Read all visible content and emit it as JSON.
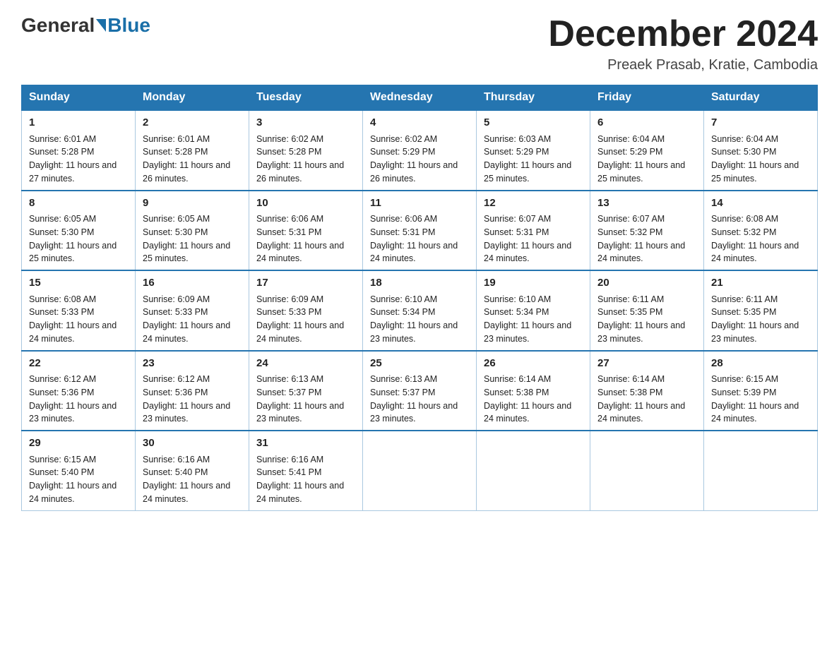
{
  "header": {
    "logo_general": "General",
    "logo_blue": "Blue",
    "month_title": "December 2024",
    "location": "Preaek Prasab, Kratie, Cambodia"
  },
  "days_of_week": [
    "Sunday",
    "Monday",
    "Tuesday",
    "Wednesday",
    "Thursday",
    "Friday",
    "Saturday"
  ],
  "weeks": [
    [
      {
        "day": "1",
        "sunrise": "6:01 AM",
        "sunset": "5:28 PM",
        "daylight": "11 hours and 27 minutes."
      },
      {
        "day": "2",
        "sunrise": "6:01 AM",
        "sunset": "5:28 PM",
        "daylight": "11 hours and 26 minutes."
      },
      {
        "day": "3",
        "sunrise": "6:02 AM",
        "sunset": "5:28 PM",
        "daylight": "11 hours and 26 minutes."
      },
      {
        "day": "4",
        "sunrise": "6:02 AM",
        "sunset": "5:29 PM",
        "daylight": "11 hours and 26 minutes."
      },
      {
        "day": "5",
        "sunrise": "6:03 AM",
        "sunset": "5:29 PM",
        "daylight": "11 hours and 25 minutes."
      },
      {
        "day": "6",
        "sunrise": "6:04 AM",
        "sunset": "5:29 PM",
        "daylight": "11 hours and 25 minutes."
      },
      {
        "day": "7",
        "sunrise": "6:04 AM",
        "sunset": "5:30 PM",
        "daylight": "11 hours and 25 minutes."
      }
    ],
    [
      {
        "day": "8",
        "sunrise": "6:05 AM",
        "sunset": "5:30 PM",
        "daylight": "11 hours and 25 minutes."
      },
      {
        "day": "9",
        "sunrise": "6:05 AM",
        "sunset": "5:30 PM",
        "daylight": "11 hours and 25 minutes."
      },
      {
        "day": "10",
        "sunrise": "6:06 AM",
        "sunset": "5:31 PM",
        "daylight": "11 hours and 24 minutes."
      },
      {
        "day": "11",
        "sunrise": "6:06 AM",
        "sunset": "5:31 PM",
        "daylight": "11 hours and 24 minutes."
      },
      {
        "day": "12",
        "sunrise": "6:07 AM",
        "sunset": "5:31 PM",
        "daylight": "11 hours and 24 minutes."
      },
      {
        "day": "13",
        "sunrise": "6:07 AM",
        "sunset": "5:32 PM",
        "daylight": "11 hours and 24 minutes."
      },
      {
        "day": "14",
        "sunrise": "6:08 AM",
        "sunset": "5:32 PM",
        "daylight": "11 hours and 24 minutes."
      }
    ],
    [
      {
        "day": "15",
        "sunrise": "6:08 AM",
        "sunset": "5:33 PM",
        "daylight": "11 hours and 24 minutes."
      },
      {
        "day": "16",
        "sunrise": "6:09 AM",
        "sunset": "5:33 PM",
        "daylight": "11 hours and 24 minutes."
      },
      {
        "day": "17",
        "sunrise": "6:09 AM",
        "sunset": "5:33 PM",
        "daylight": "11 hours and 24 minutes."
      },
      {
        "day": "18",
        "sunrise": "6:10 AM",
        "sunset": "5:34 PM",
        "daylight": "11 hours and 23 minutes."
      },
      {
        "day": "19",
        "sunrise": "6:10 AM",
        "sunset": "5:34 PM",
        "daylight": "11 hours and 23 minutes."
      },
      {
        "day": "20",
        "sunrise": "6:11 AM",
        "sunset": "5:35 PM",
        "daylight": "11 hours and 23 minutes."
      },
      {
        "day": "21",
        "sunrise": "6:11 AM",
        "sunset": "5:35 PM",
        "daylight": "11 hours and 23 minutes."
      }
    ],
    [
      {
        "day": "22",
        "sunrise": "6:12 AM",
        "sunset": "5:36 PM",
        "daylight": "11 hours and 23 minutes."
      },
      {
        "day": "23",
        "sunrise": "6:12 AM",
        "sunset": "5:36 PM",
        "daylight": "11 hours and 23 minutes."
      },
      {
        "day": "24",
        "sunrise": "6:13 AM",
        "sunset": "5:37 PM",
        "daylight": "11 hours and 23 minutes."
      },
      {
        "day": "25",
        "sunrise": "6:13 AM",
        "sunset": "5:37 PM",
        "daylight": "11 hours and 23 minutes."
      },
      {
        "day": "26",
        "sunrise": "6:14 AM",
        "sunset": "5:38 PM",
        "daylight": "11 hours and 24 minutes."
      },
      {
        "day": "27",
        "sunrise": "6:14 AM",
        "sunset": "5:38 PM",
        "daylight": "11 hours and 24 minutes."
      },
      {
        "day": "28",
        "sunrise": "6:15 AM",
        "sunset": "5:39 PM",
        "daylight": "11 hours and 24 minutes."
      }
    ],
    [
      {
        "day": "29",
        "sunrise": "6:15 AM",
        "sunset": "5:40 PM",
        "daylight": "11 hours and 24 minutes."
      },
      {
        "day": "30",
        "sunrise": "6:16 AM",
        "sunset": "5:40 PM",
        "daylight": "11 hours and 24 minutes."
      },
      {
        "day": "31",
        "sunrise": "6:16 AM",
        "sunset": "5:41 PM",
        "daylight": "11 hours and 24 minutes."
      },
      null,
      null,
      null,
      null
    ]
  ]
}
